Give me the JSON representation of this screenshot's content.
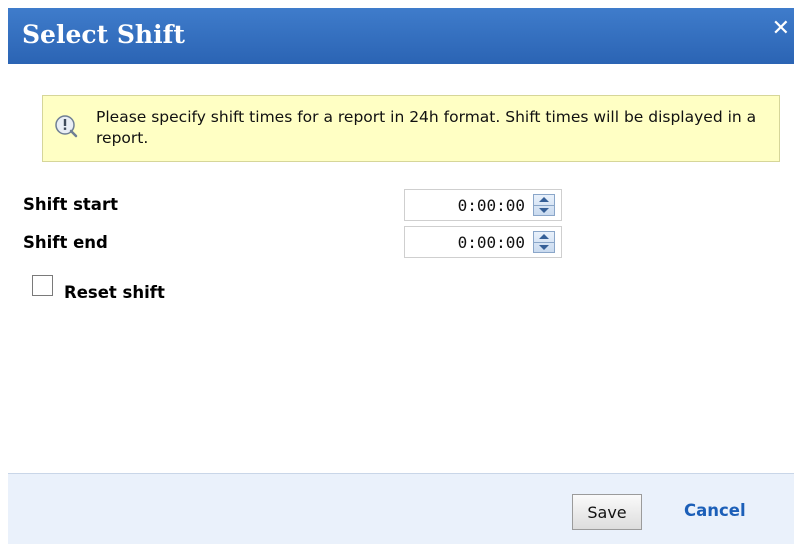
{
  "dialog": {
    "title": "Select Shift",
    "close_glyph": "✕"
  },
  "info": {
    "icon": "info-icon",
    "text": "Please specify shift times for a report in 24h format. Shift times will be displayed in a report."
  },
  "fields": {
    "shift_start": {
      "label": "Shift start",
      "value": "0:00:00"
    },
    "shift_end": {
      "label": "Shift end",
      "value": "0:00:00"
    }
  },
  "reset": {
    "label": "Reset shift",
    "checked": false
  },
  "footer": {
    "save_label": "Save",
    "cancel_label": "Cancel"
  },
  "colors": {
    "title_bar": "#2f6cbd",
    "info_background": "#ffffc4",
    "footer_background": "#eaf1fb",
    "link": "#1c5fb8"
  }
}
